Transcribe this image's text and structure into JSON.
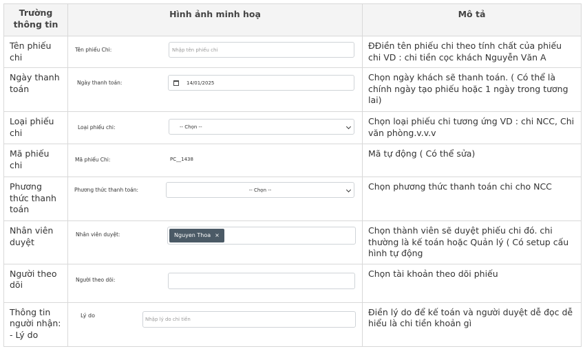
{
  "headers": {
    "field": "Trường thông tin",
    "illustration": "Hình ảnh minh hoạ",
    "description": "Mô tả"
  },
  "rows": [
    {
      "field": "Tên phiếu chi",
      "demo_label": "Tên phiếu Chi:",
      "demo_placeholder": "Nhập tên phiếu chi",
      "description": "ĐĐiền tên phiếu chi theo tính chất của phiếu chi VD : chi tiền cọc khách Nguyễn Văn A"
    },
    {
      "field": "Ngày thanh toán",
      "demo_label": "Ngày thanh toán:",
      "demo_value": "14/01/2025",
      "demo_icon": "calendar-icon",
      "description": "Chọn ngày khách sẽ thanh toán. ( Có thể là chính ngày tạo phiếu hoặc 1 ngày trong tương lai)"
    },
    {
      "field": "Loại phiếu chi",
      "demo_label": "Loại phiếu chi:",
      "demo_value": "-- Chọn --",
      "description": "Chọn loại phiếu chi tương ứng VD : chi NCC, Chi văn phòng.v.v.v"
    },
    {
      "field": "Mã phiếu chi",
      "demo_label": "Mã phiếu Chi:",
      "demo_value": "PC__1438",
      "description": "Mã tự động ( Có thể sửa)"
    },
    {
      "field": "Phương thức thanh toán",
      "demo_label": "Phương thức thanh toán:",
      "demo_value": "-- Chọn --",
      "description": "Chọn phương thức thanh toán chi cho NCC"
    },
    {
      "field": "Nhân viên duyệt",
      "demo_label": "Nhân viên duyệt:",
      "demo_tag": "Nguyen Thoa",
      "demo_tag_remove": "×",
      "description": "Chọn thành viên sẽ duyệt phiếu chi đó. chi thường là kế toán hoặc Quản lý ( Có setup cấu hình tự động"
    },
    {
      "field": "Người theo dõi",
      "demo_label": "Người theo dõi:",
      "demo_value": "",
      "description": "Chọn tài khoản theo dõi phiếu"
    },
    {
      "field": "Thông tin người nhận: - Lý do",
      "demo_label": "Lý do",
      "demo_placeholder": "Nhập lý do chi tiền",
      "description": "Điền lý do để kế toán và người duyệt dễ đọc dễ hiểu là chi tiền khoản gì"
    }
  ]
}
